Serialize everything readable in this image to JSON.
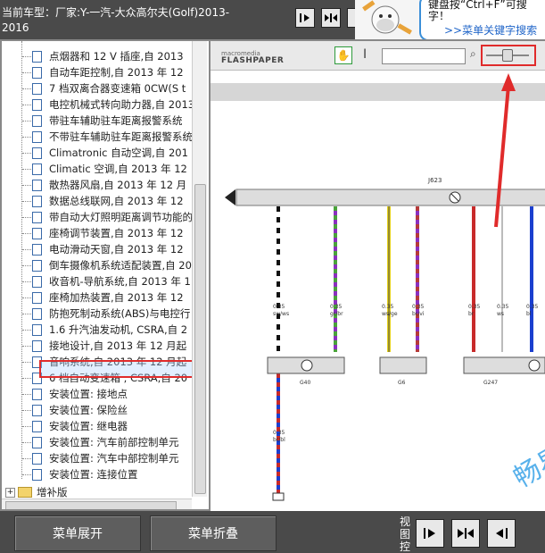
{
  "title": {
    "line1": "当前车型：厂家:Y-一汽-大众高尔夫(Golf)2013-",
    "line2": "2016"
  },
  "banner": {
    "line1": "键盘按“Ctrl+F”可搜",
    "line2": "字！",
    "line3": ">>菜单关键字搜索"
  },
  "tree": {
    "items": [
      {
        "label": "点烟器和 12 V 插座,自 2013"
      },
      {
        "label": "自动车距控制,自 2013 年 12"
      },
      {
        "label": "7 档双离合器变速箱 0CW(S t"
      },
      {
        "label": "电控机械式转向助力器,自 2013"
      },
      {
        "label": "带驻车辅助驻车距离报警系统"
      },
      {
        "label": "不带驻车辅助驻车距离报警系统"
      },
      {
        "label": "Climatronic 自动空调,自 201"
      },
      {
        "label": "Climatic 空调,自 2013 年 12"
      },
      {
        "label": "散热器风扇,自 2013 年 12 月"
      },
      {
        "label": "数据总线联网,自 2013 年 12"
      },
      {
        "label": "带自动大灯照明距离调节功能的"
      },
      {
        "label": "座椅调节装置,自 2013 年 12"
      },
      {
        "label": "电动滑动天窗,自 2013 年 12"
      },
      {
        "label": "倒车摄像机系统适配装置,自 20"
      },
      {
        "label": "收音机-导航系统,自 2013 年 1"
      },
      {
        "label": "座椅加热装置,自 2013 年 12"
      },
      {
        "label": "防抱死制动系统(ABS)与电控行"
      },
      {
        "label": "1.6 升汽油发动机, CSRA,自 2"
      },
      {
        "label": "接地设计,自 2013 年 12 月起"
      },
      {
        "label": "音响系统,自 2013 年 12 月起"
      },
      {
        "label": "6 档自动变速箱 , CSRA,自 20"
      },
      {
        "label": "安装位置: 接地点"
      },
      {
        "label": "安装位置: 保险丝"
      },
      {
        "label": "安装位置: 继电器"
      },
      {
        "label": "安装位置: 汽车前部控制单元"
      },
      {
        "label": "安装位置: 汽车中部控制单元"
      },
      {
        "label": "安装位置: 连接位置"
      }
    ],
    "folder_label": "增补版"
  },
  "diagram": {
    "labels": {
      "top": "J623",
      "b1": "0.35\nsw/ws",
      "b2": "0.35\ngr/br",
      "b3": "0.35\nws/ge",
      "b4": "0.35\nbr/vi",
      "b5": "0.35\nbr",
      "b6": "0.35\nws",
      "b7": "0.35\nbl",
      "bottom": "0.35\nbr/bl",
      "g1": "G40",
      "g2": "G6",
      "g3": "G247"
    }
  },
  "footer": {
    "expand": "菜单展开",
    "collapse": "菜单折叠",
    "view_label": "视图控"
  },
  "watermark": "畅易"
}
